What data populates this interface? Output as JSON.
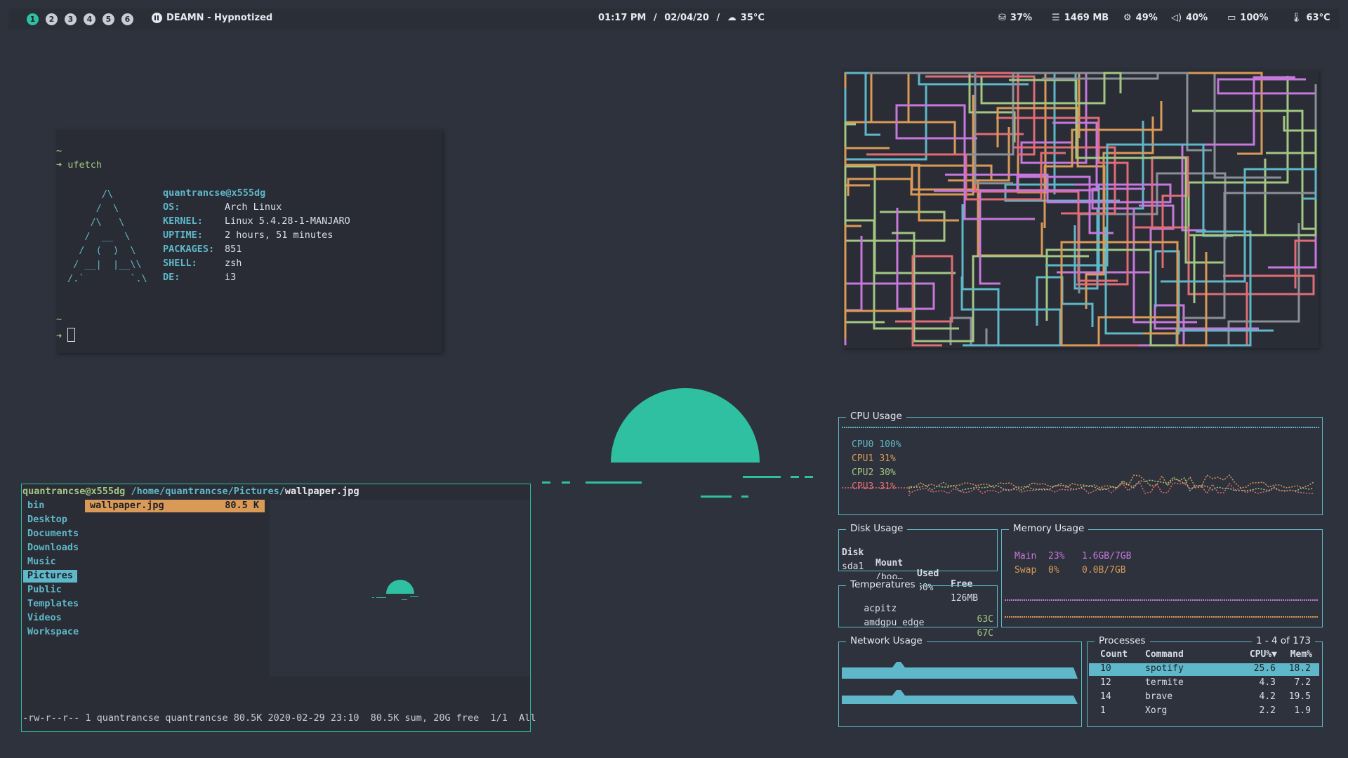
{
  "bar": {
    "workspaces": [
      "1",
      "2",
      "3",
      "4",
      "5",
      "6"
    ],
    "active_workspace": "1",
    "now_playing": "DEAMN - Hypnotized",
    "time": "01:17 PM",
    "date": "02/04/20",
    "weather": "35°C",
    "disk": "37%",
    "memory": "1469 MB",
    "cpu": "49%",
    "volume": "40%",
    "battery": "100%",
    "temp": "63°C"
  },
  "terminal": {
    "tilde1": "~",
    "prompt_arrow": "➜",
    "command": "ufetch",
    "logo": [
      "      /\\",
      "     /  \\",
      "    /\\   \\",
      "   /  __  \\",
      "  /  (  )  \\",
      " / __|  |__\\\\",
      "/.`        `.\\"
    ],
    "user_host": "quantrancse@x555dg",
    "info": [
      {
        "key": "OS:",
        "value": "Arch Linux"
      },
      {
        "key": "KERNEL:",
        "value": "Linux 5.4.28-1-MANJARO"
      },
      {
        "key": "UPTIME:",
        "value": "2 hours, 51 minutes"
      },
      {
        "key": "PACKAGES:",
        "value": "851"
      },
      {
        "key": "SHELL:",
        "value": "zsh"
      },
      {
        "key": "DE:",
        "value": "i3"
      }
    ],
    "tilde2": "~"
  },
  "file_manager": {
    "header_user": "quantrancse@x555dg",
    "header_path": "/home/quantrancse/Pictures/",
    "header_file": "wallpaper.jpg",
    "dirs": [
      "bin",
      "Desktop",
      "Documents",
      "Downloads",
      "Music",
      "Pictures",
      "Public",
      "Templates",
      "Videos",
      "Workspace"
    ],
    "selected_dir": "Pictures",
    "file_name": "wallpaper.jpg",
    "file_size": "80.5 K",
    "status": "-rw-r--r-- 1 quantrancse quantrancse 80.5K 2020-02-29 23:10  80.5K sum, 20G free  1/1  All"
  },
  "monitor": {
    "cpu_title": "CPU Usage",
    "cpus": [
      {
        "name": "CPU0",
        "value": "100%",
        "color": "#5fb8c9"
      },
      {
        "name": "CPU1",
        "value": "31%",
        "color": "#d99a57"
      },
      {
        "name": "CPU2",
        "value": "30%",
        "color": "#a3c683"
      },
      {
        "name": "CPU3",
        "value": "31%",
        "color": "#e06c75"
      }
    ],
    "disk_title": "Disk Usage",
    "disk_headers": [
      "Disk",
      "Mount",
      "Used",
      "Free"
    ],
    "disk_row": [
      "sda1",
      "/boo…",
      "50%",
      "126MB"
    ],
    "mem_title": "Memory Usage",
    "mem_rows": [
      {
        "name": "Main",
        "pct": "23%",
        "amount": "1.6GB/7GB",
        "color": "#c678dd"
      },
      {
        "name": "Swap",
        "pct": "0%",
        "amount": "0.0B/7GB",
        "color": "#d99a57"
      }
    ],
    "temp_title": "Temperatures",
    "temps": [
      {
        "name": "acpitz",
        "value": "63C"
      },
      {
        "name": "amdgpu_edge",
        "value": "67C"
      }
    ],
    "net_title": "Network Usage",
    "proc_title": "Processes",
    "proc_count": "1 - 4 of 173",
    "proc_headers": [
      "Count",
      "Command",
      "CPU%▼",
      "Mem%"
    ],
    "procs": [
      [
        "10",
        "spotify",
        "25.6",
        "18.2"
      ],
      [
        "12",
        "termite",
        "4.3",
        "7.2"
      ],
      [
        "14",
        "brave",
        "4.2",
        "19.5"
      ],
      [
        "1",
        "Xorg",
        "2.2",
        "1.9"
      ]
    ]
  },
  "colors": {
    "accent": "#2fbfa1",
    "teal": "#5fb8c9",
    "bg": "#2e323c"
  }
}
